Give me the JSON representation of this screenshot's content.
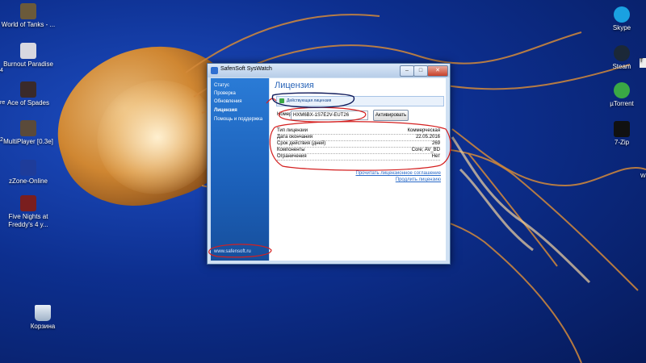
{
  "desktop": {
    "left_icons": [
      {
        "label": "World of Tanks - ...",
        "icon": "tank-icon",
        "color": "#6b5a3a"
      },
      {
        "label": "Burnout Paradise",
        "icon": "car-game-icon",
        "color": "#d8d8e0"
      },
      {
        "label": "Ace of Spades",
        "icon": "spades-game-icon",
        "color": "#3a2a2a"
      },
      {
        "label": "MultiPlayer [0.3e]",
        "icon": "multiplayer-icon",
        "color": "#5a4a3a"
      },
      {
        "label": "zZone-Online",
        "icon": "zone-icon",
        "color": "#1e3c9a"
      },
      {
        "label": "Five Nights at Freddy's 4 y...",
        "icon": "fnaf-icon",
        "color": "#7a1e1e"
      }
    ],
    "recycle_bin": {
      "label": "Корзина",
      "icon": "recycle-bin-icon"
    },
    "right_icons": [
      {
        "label": "Skype",
        "icon": "skype-icon",
        "color": "#1aa1e1"
      },
      {
        "label": "Steam",
        "icon": "steam-icon",
        "color": "#1b2838"
      },
      {
        "label": "µTorrent",
        "icon": "utorrent-icon",
        "color": "#3aa845"
      },
      {
        "label": "7-Zip",
        "icon": "7zip-icon",
        "color": "#111111"
      }
    ],
    "edge_fragments": {
      "a": "4",
      "b": "re",
      "c": "2"
    },
    "right_edge_fragments": {
      "a": "T",
      "b": "W"
    }
  },
  "window": {
    "title": "SafenSoft SysWatch",
    "controls": {
      "minimize": "–",
      "maximize": "□",
      "close": "✕"
    },
    "sidebar": {
      "items": [
        "Статус",
        "Проверка",
        "Обновления",
        "Лицензия",
        "Помощь и поддержка"
      ],
      "active_index": 3,
      "site": "www.safensoft.ru"
    },
    "content": {
      "title": "Лицензия",
      "active_license": "Действующая лицензия",
      "key_label": "Номер",
      "key_value": "HXM6BX-1S7E2V-EUT26",
      "activate_button": "Активировать",
      "details": [
        {
          "k": "Тип лицензии",
          "v": "Коммерческая"
        },
        {
          "k": "Дата окончания",
          "v": "22.05.2016"
        },
        {
          "k": "Срок действия (дней)",
          "v": "269"
        },
        {
          "k": "Компоненты",
          "v": "Core; AV_BD"
        },
        {
          "k": "Ограничения",
          "v": "Нет"
        }
      ],
      "links": [
        "Прочитать лицензионное соглашение",
        "Продлить лицензию"
      ]
    }
  },
  "colors": {
    "accent": "#2a65b8",
    "sidebar": "#1b5fb8",
    "annotation_red": "#d42020",
    "annotation_navy": "#101a5a"
  }
}
